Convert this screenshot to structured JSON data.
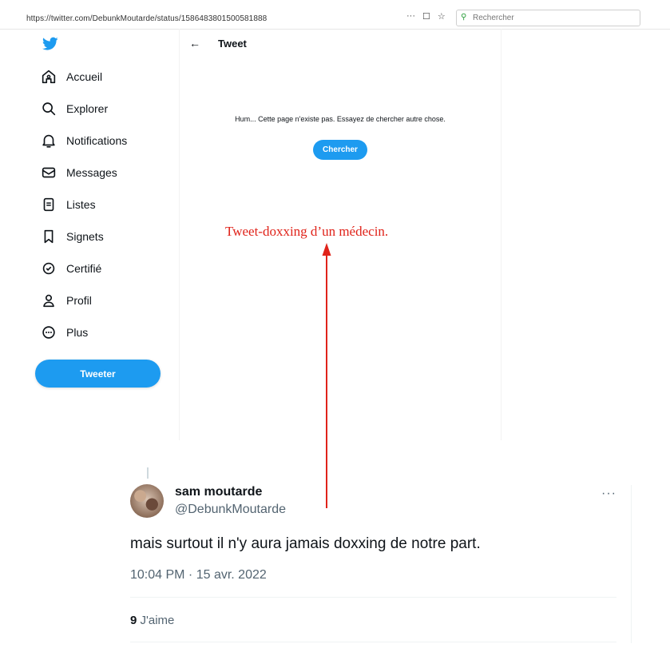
{
  "browser": {
    "url": "https://twitter.com/DebunkMoutarde/status/1586483801500581888",
    "actions": [
      "···",
      "☐",
      "☆"
    ],
    "search_placeholder": "Rechercher"
  },
  "sidebar": {
    "items": [
      {
        "label": "Accueil",
        "icon": "home-icon"
      },
      {
        "label": "Explorer",
        "icon": "search-icon"
      },
      {
        "label": "Notifications",
        "icon": "bell-icon"
      },
      {
        "label": "Messages",
        "icon": "envelope-icon"
      },
      {
        "label": "Listes",
        "icon": "list-icon"
      },
      {
        "label": "Signets",
        "icon": "bookmark-icon"
      },
      {
        "label": "Certifié",
        "icon": "verified-icon"
      },
      {
        "label": "Profil",
        "icon": "person-icon"
      },
      {
        "label": "Plus",
        "icon": "more-circle-icon"
      }
    ],
    "tweet_button": "Tweeter"
  },
  "main": {
    "title": "Tweet",
    "not_found": "Hum... Cette page n'existe pas. Essayez de chercher autre chose.",
    "search_button": "Chercher"
  },
  "annotation": {
    "text": "Tweet-doxxing d’un médecin.",
    "color": "#e0231a"
  },
  "tweet": {
    "author_name": "sam moutarde",
    "author_handle": "@DebunkMoutarde",
    "text": "mais surtout il n'y aura jamais doxxing de notre part.",
    "timestamp": "10:04 PM · 15 avr. 2022",
    "likes_count": "9",
    "likes_label": "J'aime",
    "more": "···"
  },
  "colors": {
    "accent": "#1d9bf0",
    "text_primary": "#0f1419",
    "text_secondary": "#536471"
  }
}
